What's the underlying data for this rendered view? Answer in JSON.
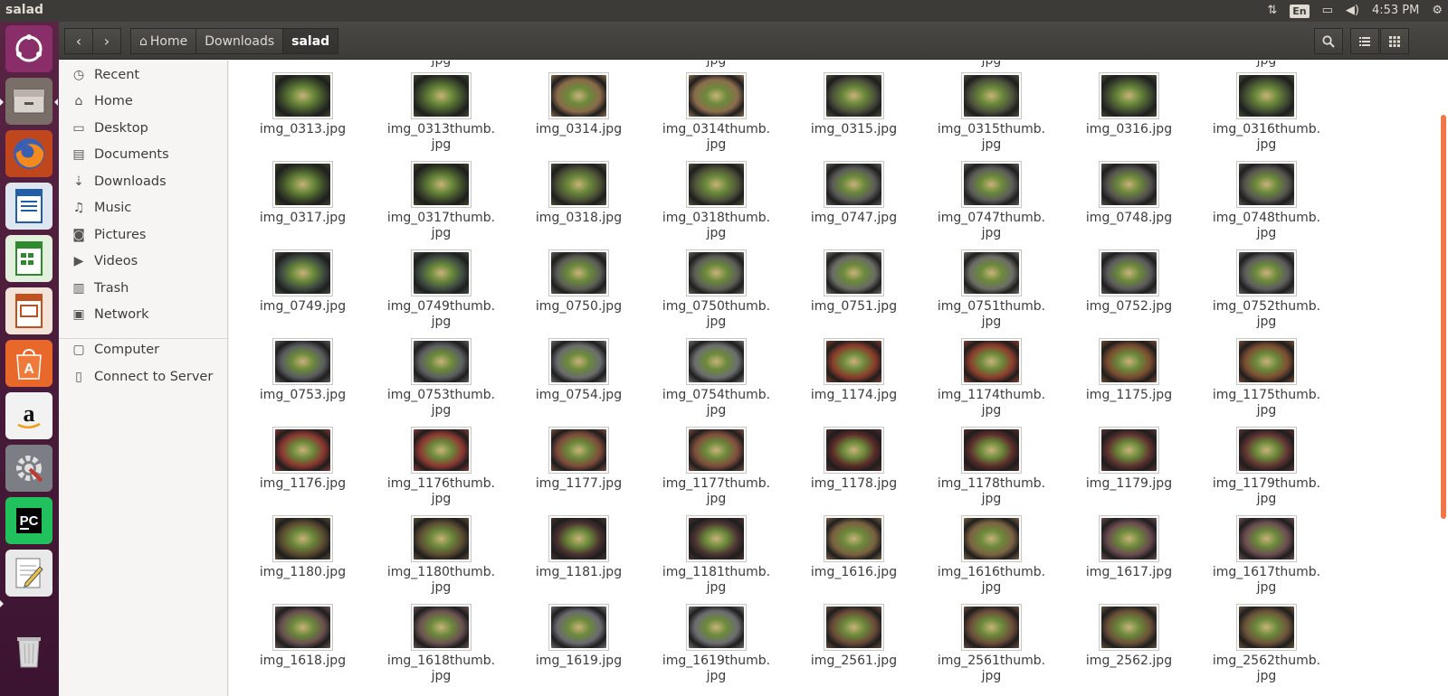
{
  "window": {
    "title": "salad"
  },
  "indicators": {
    "lang": "En",
    "time": "4:53 PM"
  },
  "launcher": {
    "items": [
      {
        "name": "dash-home",
        "glyph": "◉"
      },
      {
        "name": "files",
        "glyph": "▭"
      },
      {
        "name": "firefox",
        "glyph": "◎"
      },
      {
        "name": "writer",
        "glyph": "≡"
      },
      {
        "name": "calc",
        "glyph": "▦"
      },
      {
        "name": "impress",
        "glyph": "▣"
      },
      {
        "name": "software-center",
        "glyph": "A"
      },
      {
        "name": "amazon",
        "glyph": "a"
      },
      {
        "name": "system-settings",
        "glyph": "⚙"
      },
      {
        "name": "pycharm",
        "glyph": "PC"
      },
      {
        "name": "text-editor",
        "glyph": "✎"
      },
      {
        "name": "trash",
        "glyph": "🗑"
      }
    ]
  },
  "nav": {
    "back": "‹",
    "forward": "›"
  },
  "breadcrumb": {
    "home": "Home",
    "downloads": "Downloads",
    "current": "salad"
  },
  "sidebar": {
    "items": [
      {
        "label": "Recent",
        "icon": "◷"
      },
      {
        "label": "Home",
        "icon": "⌂"
      },
      {
        "label": "Desktop",
        "icon": "▭"
      },
      {
        "label": "Documents",
        "icon": "▤"
      },
      {
        "label": "Downloads",
        "icon": "⇣"
      },
      {
        "label": "Music",
        "icon": "♫"
      },
      {
        "label": "Pictures",
        "icon": "◙"
      },
      {
        "label": "Videos",
        "icon": "▶"
      },
      {
        "label": "Trash",
        "icon": "▥"
      },
      {
        "label": "Network",
        "icon": "▣"
      },
      {
        "label": "Computer",
        "icon": "▢"
      },
      {
        "label": "Connect to Server",
        "icon": "▯"
      }
    ]
  },
  "cut_row_labels": [
    "jpg",
    "jpg",
    "jpg",
    "jpg"
  ],
  "files": [
    {
      "name": "img_0313.jpg",
      "line2": "",
      "color": "#3b4a2a"
    },
    {
      "name": "img_0313thumb.",
      "line2": "jpg",
      "color": "#3d4c2c"
    },
    {
      "name": "img_0314.jpg",
      "line2": "",
      "color": "#8a6a4a"
    },
    {
      "name": "img_0314thumb.",
      "line2": "jpg",
      "color": "#8c6c4c"
    },
    {
      "name": "img_0315.jpg",
      "line2": "",
      "color": "#4a4f3a"
    },
    {
      "name": "img_0315thumb.",
      "line2": "jpg",
      "color": "#4c513c"
    },
    {
      "name": "img_0316.jpg",
      "line2": "",
      "color": "#3f4a30"
    },
    {
      "name": "img_0316thumb.",
      "line2": "jpg",
      "color": "#414c32"
    },
    {
      "name": "img_0317.jpg",
      "line2": "",
      "color": "#3a4628"
    },
    {
      "name": "img_0317thumb.",
      "line2": "jpg",
      "color": "#3c482a"
    },
    {
      "name": "img_0318.jpg",
      "line2": "",
      "color": "#4b5036"
    },
    {
      "name": "img_0318thumb.",
      "line2": "jpg",
      "color": "#4d5238"
    },
    {
      "name": "img_0747.jpg",
      "line2": "",
      "color": "#5a5a58"
    },
    {
      "name": "img_0747thumb.",
      "line2": "jpg",
      "color": "#5c5c5a"
    },
    {
      "name": "img_0748.jpg",
      "line2": "",
      "color": "#55524e"
    },
    {
      "name": "img_0748thumb.",
      "line2": "jpg",
      "color": "#575450"
    },
    {
      "name": "img_0749.jpg",
      "line2": "",
      "color": "#3d4a40"
    },
    {
      "name": "img_0749thumb.",
      "line2": "jpg",
      "color": "#3f4c42"
    },
    {
      "name": "img_0750.jpg",
      "line2": "",
      "color": "#5b5d55"
    },
    {
      "name": "img_0750thumb.",
      "line2": "jpg",
      "color": "#5d5f57"
    },
    {
      "name": "img_0751.jpg",
      "line2": "",
      "color": "#6a6b64"
    },
    {
      "name": "img_0751thumb.",
      "line2": "jpg",
      "color": "#6c6d66"
    },
    {
      "name": "img_0752.jpg",
      "line2": "",
      "color": "#5c5a5c"
    },
    {
      "name": "img_0752thumb.",
      "line2": "jpg",
      "color": "#5e5c5e"
    },
    {
      "name": "img_0753.jpg",
      "line2": "",
      "color": "#5a5c60"
    },
    {
      "name": "img_0753thumb.",
      "line2": "jpg",
      "color": "#5c5e62"
    },
    {
      "name": "img_0754.jpg",
      "line2": "",
      "color": "#6a6c6e"
    },
    {
      "name": "img_0754thumb.",
      "line2": "jpg",
      "color": "#6c6e70"
    },
    {
      "name": "img_1174.jpg",
      "line2": "",
      "color": "#8a3a2a"
    },
    {
      "name": "img_1174thumb.",
      "line2": "jpg",
      "color": "#8c3c2c"
    },
    {
      "name": "img_1175.jpg",
      "line2": "",
      "color": "#7a4a30"
    },
    {
      "name": "img_1175thumb.",
      "line2": "jpg",
      "color": "#7c4c32"
    },
    {
      "name": "img_1176.jpg",
      "line2": "",
      "color": "#8a3530"
    },
    {
      "name": "img_1176thumb.",
      "line2": "jpg",
      "color": "#8c3732"
    },
    {
      "name": "img_1177.jpg",
      "line2": "",
      "color": "#7d4a3a"
    },
    {
      "name": "img_1177thumb.",
      "line2": "jpg",
      "color": "#7f4c3c"
    },
    {
      "name": "img_1178.jpg",
      "line2": "",
      "color": "#5a2a28"
    },
    {
      "name": "img_1178thumb.",
      "line2": "jpg",
      "color": "#5c2c2a"
    },
    {
      "name": "img_1179.jpg",
      "line2": "",
      "color": "#5e3030"
    },
    {
      "name": "img_1179thumb.",
      "line2": "jpg",
      "color": "#603232"
    },
    {
      "name": "img_1180.jpg",
      "line2": "",
      "color": "#5a4a30"
    },
    {
      "name": "img_1180thumb.",
      "line2": "jpg",
      "color": "#5c4c32"
    },
    {
      "name": "img_1181.jpg",
      "line2": "",
      "color": "#4a3030"
    },
    {
      "name": "img_1181thumb.",
      "line2": "jpg",
      "color": "#4c3232"
    },
    {
      "name": "img_1616.jpg",
      "line2": "",
      "color": "#7a6040"
    },
    {
      "name": "img_1616thumb.",
      "line2": "jpg",
      "color": "#7c6242"
    },
    {
      "name": "img_1617.jpg",
      "line2": "",
      "color": "#6a4a50"
    },
    {
      "name": "img_1617thumb.",
      "line2": "jpg",
      "color": "#6c4c52"
    },
    {
      "name": "img_1618.jpg",
      "line2": "",
      "color": "#6a5050"
    },
    {
      "name": "img_1618thumb.",
      "line2": "jpg",
      "color": "#6c5252"
    },
    {
      "name": "img_1619.jpg",
      "line2": "",
      "color": "#6a6a70"
    },
    {
      "name": "img_1619thumb.",
      "line2": "jpg",
      "color": "#6c6c72"
    },
    {
      "name": "img_2561.jpg",
      "line2": "",
      "color": "#6a4a38"
    },
    {
      "name": "img_2561thumb.",
      "line2": "jpg",
      "color": "#6c4c3a"
    },
    {
      "name": "img_2562.jpg",
      "line2": "",
      "color": "#6a5038"
    },
    {
      "name": "img_2562thumb.",
      "line2": "jpg",
      "color": "#6c523a"
    }
  ],
  "colors": {
    "panel": "#3c3b37",
    "launcher": "#4a1a3a",
    "scrollbar": "#f07746"
  }
}
